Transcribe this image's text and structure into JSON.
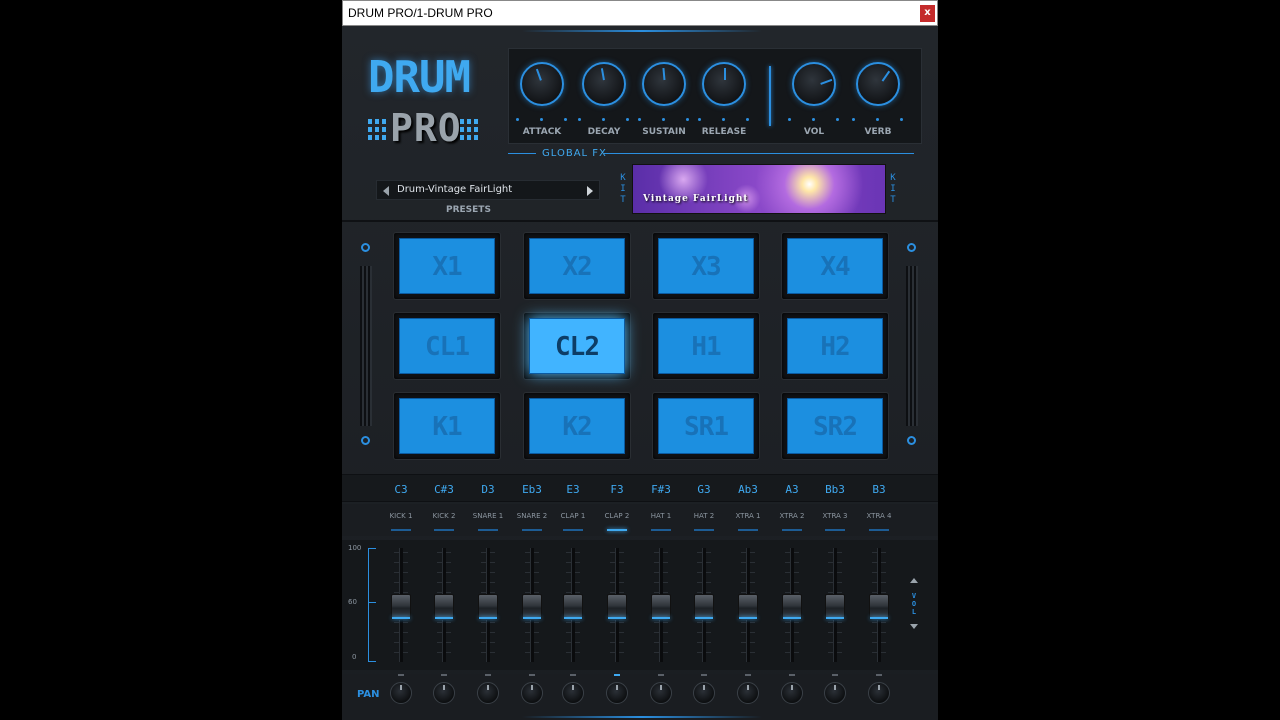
{
  "window": {
    "title": "DRUM PRO/1-DRUM PRO",
    "close": "x"
  },
  "logo": {
    "line1": "DRUM",
    "line2": "PRO"
  },
  "global_fx": {
    "label": "GLOBAL FX",
    "knobs": [
      {
        "label": "ATTACK"
      },
      {
        "label": "DECAY"
      },
      {
        "label": "SUSTAIN"
      },
      {
        "label": "RELEASE"
      },
      {
        "label": "VOL"
      },
      {
        "label": "VERB"
      }
    ]
  },
  "presets": {
    "current": "Drum-Vintage FairLight",
    "label": "PRESETS"
  },
  "kit": {
    "side_label": "KIT",
    "name": "Vintage FairLight"
  },
  "pads": [
    "X1",
    "X2",
    "X3",
    "X4",
    "CL1",
    "CL2",
    "H1",
    "H2",
    "K1",
    "K2",
    "SR1",
    "SR2"
  ],
  "active_pad": "CL2",
  "notes": [
    "C3",
    "C#3",
    "D3",
    "Eb3",
    "E3",
    "F3",
    "F#3",
    "G3",
    "Ab3",
    "A3",
    "Bb3",
    "B3"
  ],
  "instruments": [
    "KICK 1",
    "KICK 2",
    "SNARE 1",
    "SNARE 2",
    "CLAP 1",
    "CLAP 2",
    "HAT 1",
    "HAT 2",
    "XTRA 1",
    "XTRA 2",
    "XTRA 3",
    "XTRA 4"
  ],
  "active_instrument": "CLAP 2",
  "mixer": {
    "scale": [
      "100",
      "60",
      "0"
    ],
    "side_label": "VOL",
    "pan_label": "PAN"
  },
  "colors": {
    "accent": "#2b8fe0",
    "pad": "#1c8fe0",
    "pad_active": "#41b4ff",
    "background": "#1b1e22"
  }
}
